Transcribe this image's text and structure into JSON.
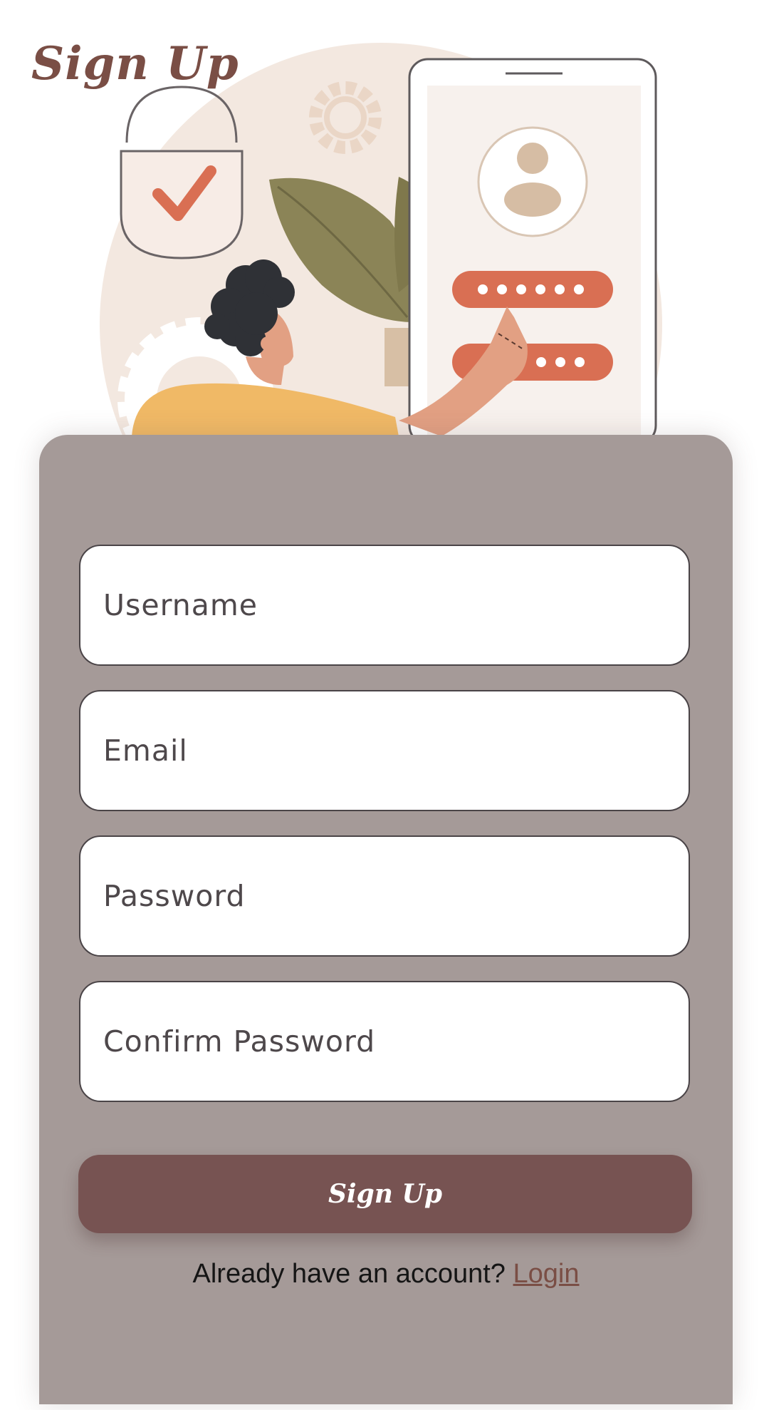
{
  "header": {
    "title": "Sign Up"
  },
  "form": {
    "username_placeholder": "Username",
    "email_placeholder": "Email",
    "password_placeholder": "Password",
    "confirm_password_placeholder": "Confirm Password",
    "submit_label": "Sign Up",
    "login_prompt": "Already have an account?",
    "login_link_label": "Login"
  },
  "colors": {
    "title": "#7a4e45",
    "card_background": "#a59a98",
    "button": "#775352",
    "link": "#7a4e45"
  },
  "illustration": {
    "icons": [
      "padlock-check-icon",
      "gear-icon",
      "phone-icon",
      "user-avatar-icon",
      "password-dots-icon",
      "leaf-plant-icon",
      "person-icon"
    ]
  }
}
